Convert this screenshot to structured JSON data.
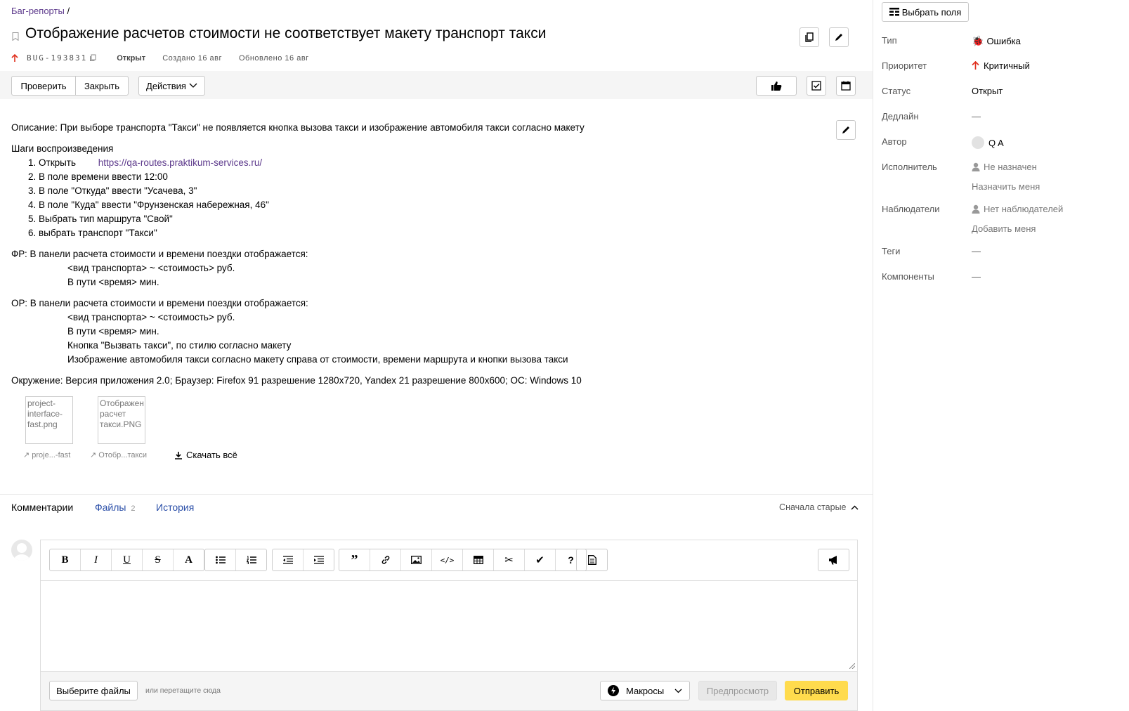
{
  "breadcrumb": {
    "label": "Баг-репорты",
    "sep": "/"
  },
  "issue": {
    "title": "Отображение расчетов стоимости не соответствует макету транспорт такси",
    "key": "BUG-193831",
    "status": "Открыт",
    "created": "Создано 16 авг",
    "updated": "Обновлено 16 авг"
  },
  "toolbar": {
    "check_label": "Проверить",
    "close_label": "Закрыть",
    "actions_label": "Действия"
  },
  "description": {
    "text": "Описание: При выборе транспорта \"Такси\" не появляется кнопка вызова такси и изображение автомобиля такси согласно макету",
    "steps_title": "Шаги воспроизведения",
    "step1_prefix": "1. Открыть",
    "step1_link": "https://qa-routes.praktikum-services.ru/",
    "steps": [
      "2. В поле времени ввести 12:00",
      "3. В поле \"Откуда\" ввести \"Усачева, 3\"",
      "4. В поле \"Куда\" ввести \"Фрунзенская набережная, 46\"",
      "5. Выбрать тип маршрута \"Свой\"",
      "6. выбрать транспорт \"Такси\""
    ],
    "fr_title": "ФР: В панели расчета стоимости и времени поездки отображается:",
    "fr_lines": [
      "<вид транспорта> ~ <стоимость> руб.",
      "В пути <время> мин."
    ],
    "or_title": "ОР: В панели расчета стоимости и времени поездки отображается:",
    "or_lines": [
      "<вид транспорта> ~ <стоимость> руб.",
      "В пути <время> мин.",
      "Кнопка \"Вызвать такси\", по стилю согласно макету",
      "Изображение автомобиля такси согласно макету справа от стоимости, времени маршрута и кнопки вызова такси"
    ],
    "env": "Окружение: Версия приложения 2.0; Браузер: Firefox 91 разрешение 1280x720, Yandex 21 разрешение 800x600; ОС: Windows 10"
  },
  "attachments": [
    {
      "alt": "project-interface-fast.png",
      "caption": "proje...-fast"
    },
    {
      "alt": "Отображен расчет такси.PNG",
      "caption": "Отобр...такси"
    }
  ],
  "download_all": "Скачать всё",
  "tabs": {
    "comments": "Комментарии",
    "files": "Файлы",
    "files_count": "2",
    "history": "История",
    "sort": "Сначала старые"
  },
  "editor": {
    "choose_files": "Выберите файлы",
    "drop_hint": "или перетащите сюда",
    "macros": "Макросы",
    "preview": "Предпросмотр",
    "send": "Отправить"
  },
  "sidebar": {
    "select_fields": "Выбрать поля",
    "fields": {
      "type_label": "Тип",
      "type_value": "Ошибка",
      "priority_label": "Приоритет",
      "priority_value": "Критичный",
      "status_label": "Статус",
      "status_value": "Открыт",
      "deadline_label": "Дедлайн",
      "deadline_value": "—",
      "author_label": "Автор",
      "author_value": "Q A",
      "assignee_label": "Исполнитель",
      "assignee_value": "Не назначен",
      "assign_me": "Назначить меня",
      "watchers_label": "Наблюдатели",
      "watchers_value": "Нет наблюдателей",
      "add_me": "Добавить меня",
      "tags_label": "Теги",
      "tags_value": "—",
      "components_label": "Компоненты",
      "components_value": "—"
    }
  },
  "colors": {
    "accent": "#ffdb4d",
    "link": "#5d3a8c",
    "priority": "#e0301e"
  }
}
